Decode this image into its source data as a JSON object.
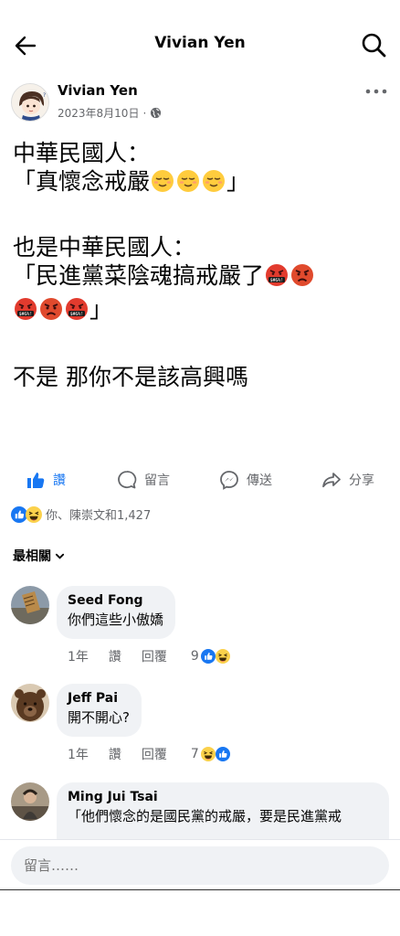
{
  "header": {
    "title": "Vivian Yen",
    "back_icon": "arrow-left-icon",
    "search_icon": "search-icon"
  },
  "post": {
    "author": "Vivian Yen",
    "date": "2023年8月10日",
    "separator": "·",
    "privacy_icon": "globe-icon",
    "more_icon": "more-horizontal-icon",
    "lines": {
      "l1": "中華民國人：",
      "l2a": "「真懷念戒嚴",
      "l2b": "」",
      "l3": "也是中華民國人：",
      "l4a": "「民進黨菜陰魂搞戒嚴了",
      "l5b": "」",
      "l6": "不是 那你不是該高興嗎"
    }
  },
  "actions": {
    "like": "讚",
    "comment": "留言",
    "send": "傳送",
    "share": "分享"
  },
  "reactions": {
    "summary": "你、陳崇文和1,427"
  },
  "sort": {
    "label": "最相關"
  },
  "comments": [
    {
      "name": "Seed Fong",
      "text": "你們這些小傲嬌",
      "age": "1年",
      "like": "讚",
      "reply": "回覆",
      "count": "9"
    },
    {
      "name": "Jeff Pai",
      "text": "開不開心?",
      "age": "1年",
      "like": "讚",
      "reply": "回覆",
      "count": "7"
    },
    {
      "name": "Ming Jui Tsai",
      "text": "「他們懷念的是國民黨的戒嚴，要是民進黨戒"
    }
  ],
  "composer": {
    "placeholder": "留言……"
  },
  "colors": {
    "accent": "#1877f2",
    "bubble": "#f0f2f5",
    "muted": "#65676b",
    "text": "#050505"
  }
}
